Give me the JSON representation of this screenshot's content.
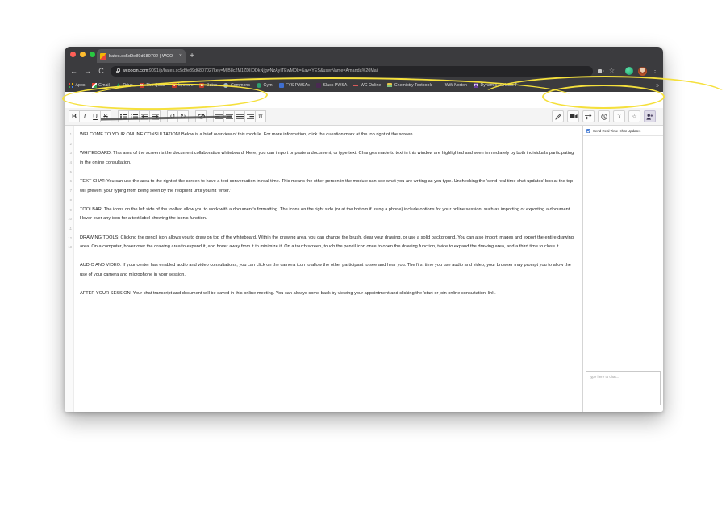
{
  "browser": {
    "tab": {
      "title": "bates.sc5d9e89d680702 | WCO",
      "favicon": "colored-square-favicon",
      "close_label": "×"
    },
    "new_tab_label": "+",
    "nav": {
      "back": "←",
      "forward": "→",
      "reload": "C",
      "lock": "lock-icon"
    },
    "address": {
      "host": "wcoocm.com",
      "path": ":9091/p/bates.sc5d9e89d6807027key=MjB8c2M1ZDlIODkNjgwNzAyITEwMDk=&av=YES&userName=Amanda%20Mai",
      "full": "wcoocm.com:9091/p/bates.sc5d9e89d6807027key=MjB8c2M1ZDlIODkNjgwNzAyITEwMDk=&av=YES&userName=Amanda%20Mai"
    },
    "toolbar_right": {
      "cast": "cast-icon",
      "bookmark": "star-icon",
      "extension": "extension-icon",
      "profile": "avatar",
      "menu": "⋮"
    },
    "bookmarks": [
      {
        "label": "Apps",
        "icon": "apps-grid-icon"
      },
      {
        "label": "Gmail",
        "icon": "gmail-icon"
      },
      {
        "label": "Drive",
        "icon": "drive-icon"
      },
      {
        "label": "The Quad",
        "icon": "letter-b-icon"
      },
      {
        "label": "Lyceum",
        "icon": "letter-b-icon"
      },
      {
        "label": "Bates",
        "icon": "letter-b-icon"
      },
      {
        "label": "Commons",
        "icon": "globe-icon"
      },
      {
        "label": "Gym",
        "icon": "globe-icon"
      },
      {
        "label": "FYS PWSAs",
        "icon": "blue-square-icon"
      },
      {
        "label": "Slack PWSA",
        "icon": "slack-icon"
      },
      {
        "label": "WC Online",
        "icon": "dash-icon"
      },
      {
        "label": "Chemistry Textbook",
        "icon": "stripes-icon"
      },
      {
        "label": "WW Norton",
        "icon": "none-icon"
      },
      {
        "label": "Dynamic Periodic T",
        "icon": "purple-pt-icon"
      }
    ],
    "bookmarks_overflow": "»"
  },
  "app": {
    "toolbar_left": [
      {
        "name": "bold-button",
        "glyph": "B"
      },
      {
        "name": "italic-button",
        "glyph": "I"
      },
      {
        "name": "underline-button",
        "glyph": "U"
      },
      {
        "name": "strikethrough-button",
        "glyph": "S"
      },
      {
        "name": "bullet-list-button",
        "glyph": "list"
      },
      {
        "name": "numbered-list-button",
        "glyph": "list"
      },
      {
        "name": "outdent-button",
        "glyph": "indent"
      },
      {
        "name": "indent-button",
        "glyph": "indent"
      },
      {
        "name": "undo-button",
        "glyph": "↺"
      },
      {
        "name": "redo-button",
        "glyph": "↻"
      },
      {
        "name": "link-button",
        "glyph": "⚭"
      },
      {
        "name": "align-left-button",
        "glyph": "align"
      },
      {
        "name": "align-center-button",
        "glyph": "align"
      },
      {
        "name": "align-justify-button",
        "glyph": "align"
      },
      {
        "name": "align-right-button",
        "glyph": "align"
      },
      {
        "name": "math-button",
        "glyph": "π"
      }
    ],
    "toolbar_right": [
      {
        "name": "pencil-draw-button",
        "glyph": "✎"
      },
      {
        "name": "video-camera-button",
        "glyph": "camera"
      },
      {
        "name": "import-export-button",
        "glyph": "⇄"
      },
      {
        "name": "timer-button",
        "glyph": "○"
      },
      {
        "name": "help-question-button",
        "glyph": "?"
      },
      {
        "name": "star-favorite-button",
        "glyph": "☆"
      },
      {
        "name": "participants-button",
        "glyph": "people"
      }
    ],
    "line_numbers": [
      "1",
      "2",
      "3",
      "4",
      "5",
      "6",
      "7",
      "8",
      "9",
      "10",
      "11",
      "12",
      "13"
    ],
    "document": {
      "paragraphs": [
        "WELCOME TO YOUR ONLINE CONSULTATION! Below is a brief overview of this module. For more information, click the question mark at the top right of the screen.",
        "WHITEBOARD: This area of the screen is the document collaboration whiteboard. Here, you can import or paste a document, or type text. Changes made to text in this window are highlighted and seen immediately by both individuals participating in the online consultation.",
        "TEXT CHAT: You can use the area to the right of the screen to have a text conversation in real time. This means the other person in the module can see what you are writing as you type. Unchecking the 'send real time chat updates' box at the top will prevent your typing from being seen by the recipient until you hit 'enter.'",
        "TOOLBAR: The icons on the left side of the toolbar allow you to work with a document's formatting. The icons on the right side (or at the bottom if using a phone) include options for your online session, such as importing or exporting a document. Hover over any icon for a text label showing the icon's function.",
        "DRAWING TOOLS: Clicking the pencil icon allows you to draw on top of the whiteboard. Within the drawing area, you can change the brush, clear your drawing, or use a solid background. You can also import images and export the entire drawing area. On a computer, hover over the drawing area to expand it, and hover away from it to minimize it. On a touch screen, touch the pencil icon once to open the drawing function, twice to expand the drawing area, and a third time to close it.",
        "AUDIO AND VIDEO: If your center has enabled audio and video consultations, you can click on the camera icon to allow the other participant to see and hear you. The first time you use audio and video, your browser may prompt you to allow the use of your camera and microphone in your session.",
        "AFTER YOUR SESSION: Your chat transcript and document will be saved in this online meeting. You can always come back by viewing your appointment and clicking the 'start or join online consultation' link."
      ]
    },
    "chat": {
      "realtime_label": "Send Real Time Chat Updates",
      "realtime_checked": true,
      "input_placeholder": "type here to chat..."
    }
  },
  "annotations": {
    "highlight_color": "#f5e03c",
    "marks": [
      "oval-around-left-formatting-toolbar",
      "oval-around-right-session-toolbar",
      "oval-across-bookmarks-bar",
      "strikethrough-on-welcome-heading"
    ]
  }
}
